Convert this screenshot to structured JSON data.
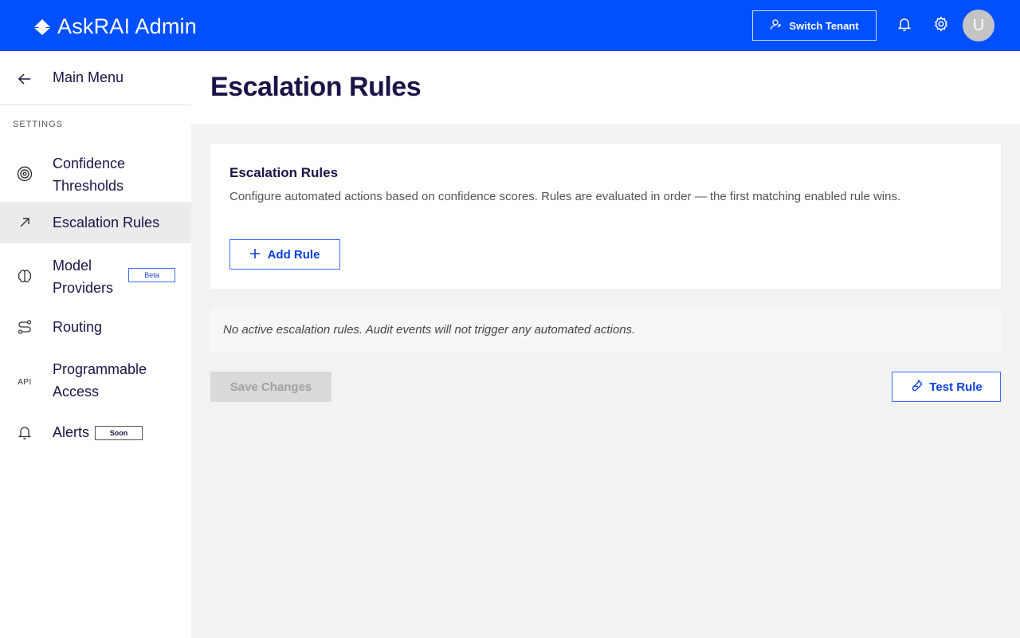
{
  "header": {
    "brand_title": "AskRAI Admin",
    "switch_tenant_label": "Switch Tenant",
    "avatar_initial": "U",
    "brand_color": "#0050ff"
  },
  "sidebar": {
    "back_label": "Main Menu",
    "section_label": "SETTINGS",
    "items": [
      {
        "label": "Confidence Thresholds",
        "icon": "target-icon",
        "active": false
      },
      {
        "label": "Escalation Rules",
        "icon": "arrow-up-right-icon",
        "active": true
      },
      {
        "label": "Model Providers",
        "icon": "brain-icon",
        "badge": "Beta",
        "active": false
      },
      {
        "label": "Routing",
        "icon": "route-icon",
        "active": false
      },
      {
        "label": "Programmable Access",
        "icon": "API",
        "active": false
      },
      {
        "label": "Alerts",
        "icon": "bell-icon",
        "badge": "Soon",
        "active": false
      }
    ]
  },
  "page": {
    "title": "Escalation Rules"
  },
  "card": {
    "title": "Escalation Rules",
    "description": "Configure automated actions based on confidence scores. Rules are evaluated in order — the first matching enabled rule wins.",
    "add_rule_label": "Add Rule"
  },
  "notice": {
    "text": "No active escalation rules. Audit events will not trigger any automated actions."
  },
  "actions": {
    "save_label": "Save Changes",
    "test_label": "Test Rule"
  }
}
